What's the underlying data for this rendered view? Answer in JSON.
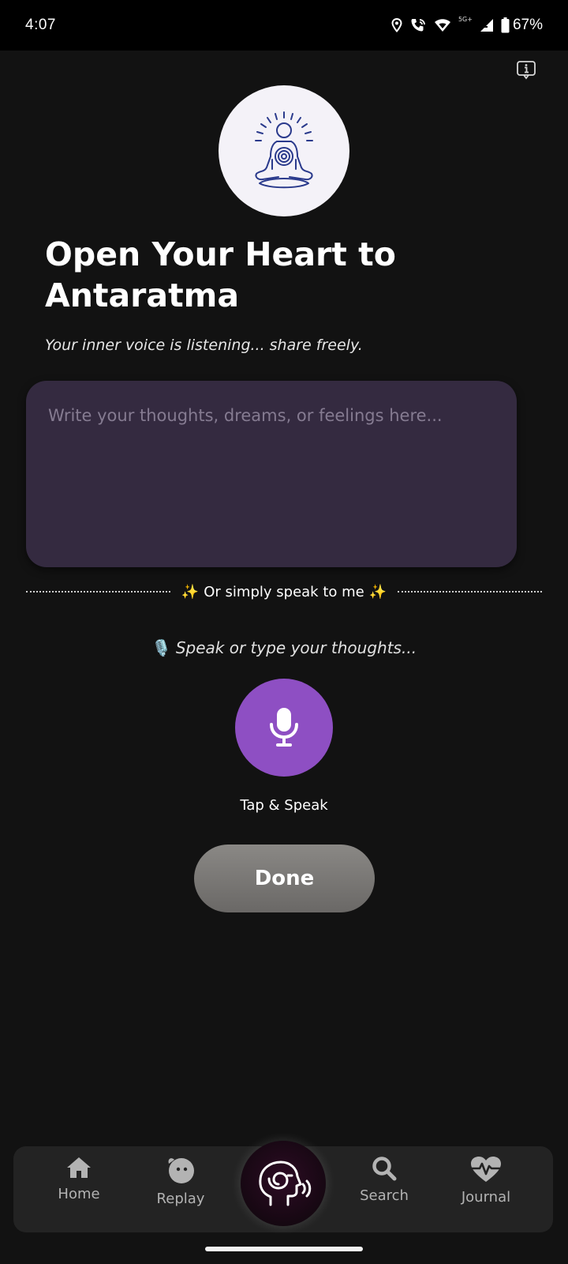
{
  "status_bar": {
    "time": "4:07",
    "network": "5G+",
    "battery": "67%"
  },
  "header": {
    "info_icon": "info-icon"
  },
  "hero": {
    "icon": "meditation-icon",
    "title": "Open Your Heart to Antaratma",
    "subtitle": "Your inner voice is listening... share freely."
  },
  "input": {
    "placeholder": "Write your thoughts, dreams, or feelings here...",
    "value": ""
  },
  "divider": {
    "text": "Or simply speak to me",
    "sparkle_left": "✨",
    "sparkle_right": "✨"
  },
  "voice": {
    "hint": "Speak or type your thoughts...",
    "hint_icon": "🎙️",
    "mic_label": "Tap & Speak",
    "accent": "#8e4fc3"
  },
  "actions": {
    "done_label": "Done"
  },
  "nav": {
    "items": [
      {
        "label": "Home",
        "icon": "home-icon"
      },
      {
        "label": "Replay",
        "icon": "replay-face-icon"
      },
      {
        "label": "",
        "icon": "head-spiral-icon"
      },
      {
        "label": "Search",
        "icon": "search-icon"
      },
      {
        "label": "Journal",
        "icon": "heart-pulse-icon"
      }
    ]
  }
}
